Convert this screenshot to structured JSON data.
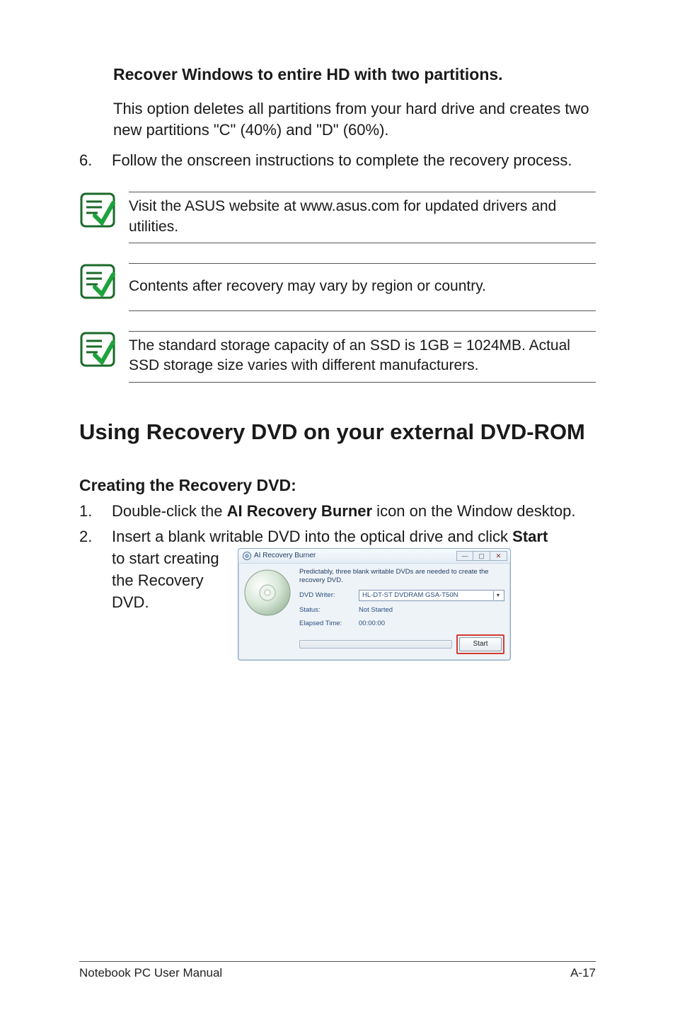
{
  "section": {
    "recover_title": "Recover Windows to entire HD with two partitions.",
    "recover_desc": "This option deletes all partitions from your hard drive and creates two new partitions \"C\" (40%) and \"D\" (60%).",
    "step6_num": "6.",
    "step6_text": "Follow the onscreen instructions to complete the recovery process.",
    "note1": "Visit the ASUS website at www.asus.com for updated drivers and utilities.",
    "note2": "Contents after recovery may vary by region or country.",
    "note3": "The standard storage capacity of an SSD is 1GB = 1024MB. Actual SSD storage size varies with different manufacturers.",
    "heading_dvd": "Using Recovery DVD on your external DVD-ROM",
    "heading_creating": "Creating the Recovery DVD:",
    "step1_num": "1.",
    "step1_pre": "Double-click the ",
    "step1_bold": "AI Recovery Burner",
    "step1_post": " icon on the Window desktop.",
    "step2_num": "2.",
    "step2_pre": "Insert a blank writable DVD into the optical drive and click ",
    "step2_bold": "Start",
    "step2_line2": "to start creating the Recovery DVD."
  },
  "ai_window": {
    "title": "AI Recovery Burner",
    "minimize": "—",
    "maximize": "▢",
    "close": "✕",
    "msg": "Predictably, three blank writable DVDs are needed to create the recovery DVD.",
    "label_writer": "DVD Writer:",
    "combo_value": "HL-DT-ST DVDRAM GSA-T50N",
    "label_status": "Status:",
    "value_status": "Not Started",
    "label_elapsed": "Elapsed Time:",
    "value_elapsed": "00:00:00",
    "start_btn": "Start"
  },
  "footer": {
    "left": "Notebook PC User Manual",
    "right": "A-17"
  }
}
